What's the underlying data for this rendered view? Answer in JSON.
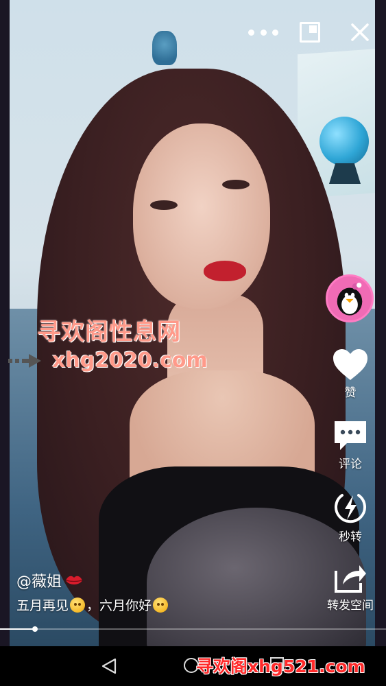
{
  "top_bar": {
    "more_icon": "more-dots-icon",
    "pip_icon": "picture-in-picture-icon",
    "close_icon": "close-icon"
  },
  "watermark": {
    "title": "寻欢阁性息网",
    "url": "xhg2020.com",
    "bottom": "寻欢阁xhg521.com"
  },
  "actions": {
    "like": "赞",
    "comment": "评论",
    "repost": "秒转",
    "share": "转发空间"
  },
  "post": {
    "author": "@薇姐",
    "caption_part1": "五月再见",
    "caption_part2": "，六月你好"
  },
  "playback": {
    "progress": 0.09
  },
  "colors": {
    "watermark_pink": "#ff9a8a",
    "watermark_red": "#ff2a2a",
    "avatar_pink": "#f06bb5"
  }
}
